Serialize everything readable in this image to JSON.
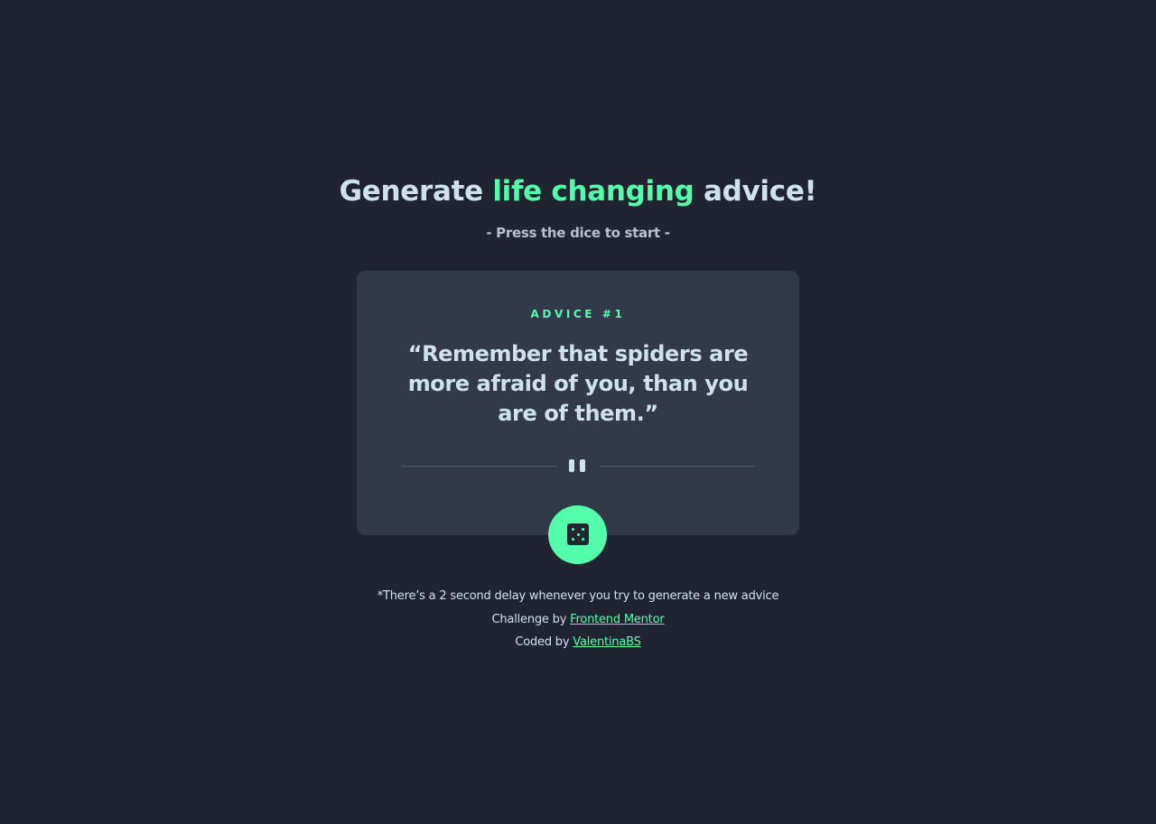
{
  "header": {
    "title_before": "Generate",
    "title_accent": "life changing",
    "title_after": "advice!",
    "subtitle": "- Press the dice to start -"
  },
  "card": {
    "advice_label": "ADVICE #1",
    "advice_text": "“Remember that spiders are more afraid of you, than you are of them.”",
    "divider_icon": "pause-icon",
    "button_icon": "dice-icon"
  },
  "footer": {
    "delay_note": "*There’s a 2 second delay whenever you try to generate a new advice",
    "challenge_prefix": "Challenge by",
    "challenge_link": "Frontend Mentor",
    "coded_prefix": "Coded by",
    "coded_link": "ValentinaBS"
  },
  "colors": {
    "background": "#1f2430",
    "card": "#323a4a",
    "accent": "#53ffab",
    "text": "#cee3e9"
  }
}
